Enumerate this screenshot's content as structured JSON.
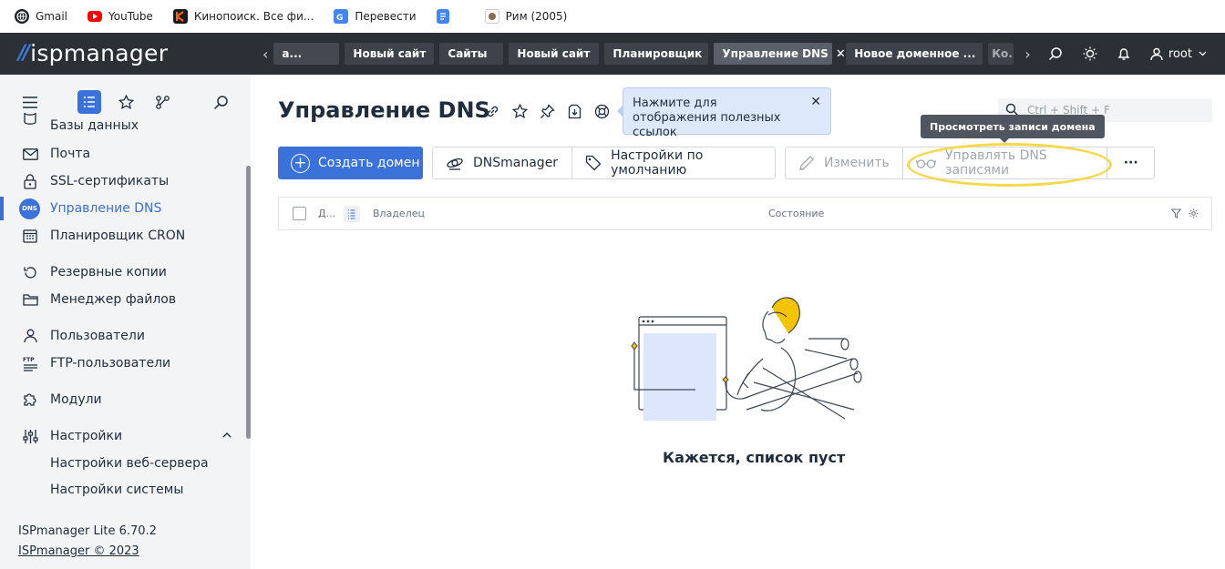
{
  "bookmarks": [
    {
      "label": "Gmail",
      "icon": "globe-icon"
    },
    {
      "label": "YouTube",
      "icon": "youtube-icon"
    },
    {
      "label": "Кинопоиск. Все фи...",
      "icon": "kinopoisk-icon"
    },
    {
      "label": "Перевести",
      "icon": "translate-icon"
    },
    {
      "label": "",
      "icon": "docs-icon"
    },
    {
      "label": "Рим (2005)",
      "icon": "film-icon"
    }
  ],
  "topbar": {
    "logo": "ispmanager",
    "tabs": [
      "а...",
      "Новый сайт",
      "Сайты",
      "Новый сайт",
      "Планировщик",
      "Управление DNS",
      "Новое доменное ...",
      "Ко..."
    ],
    "active_tab": 5,
    "user": "root"
  },
  "sidebar": {
    "items": [
      {
        "label": "Базы данных",
        "icon": "database-icon"
      },
      {
        "label": "Почта",
        "icon": "mail-icon"
      },
      {
        "label": "SSL-сертификаты",
        "icon": "lock-icon"
      },
      {
        "label": "Управление DNS",
        "icon": "dns-icon",
        "active": true
      },
      {
        "label": "Планировщик CRON",
        "icon": "calendar-icon"
      },
      {
        "label": "Резервные копии",
        "icon": "backup-icon"
      },
      {
        "label": "Менеджер файлов",
        "icon": "folder-icon"
      },
      {
        "label": "Пользователи",
        "icon": "user-icon"
      },
      {
        "label": "FTP-пользователи",
        "icon": "ftp-icon"
      },
      {
        "label": "Модули",
        "icon": "puzzle-icon"
      },
      {
        "label": "Настройки",
        "icon": "settings-sliders-icon"
      },
      {
        "label": "Настройки веб-сервера",
        "icon": ""
      },
      {
        "label": "Настройки системы",
        "icon": ""
      }
    ],
    "dns_badge": "DNS",
    "version": "ISPmanager Lite 6.70.2",
    "copyright": "ISPmanager © 2023"
  },
  "main": {
    "title": "Управление DNS",
    "hint": "Нажмите для отображения полезных ссылок",
    "search_placeholder": "Ctrl + Shift + F",
    "tooltip": "Просмотреть записи домена",
    "toolbar": {
      "create": "Создать домен",
      "dnsmanager": "DNSmanager",
      "defaults": "Настройки по умолчанию",
      "edit": "Изменить",
      "manage_records": "Управлять DNS записями",
      "more": "···"
    },
    "table": {
      "columns": [
        "Д...",
        "Владелец",
        "Состояние"
      ]
    },
    "empty_text": "Кажется, список пуст"
  },
  "colors": {
    "topbar": "#2b2f36",
    "accent": "#3b72d9",
    "highlight": "#f5d94a",
    "sidebar": "#f3f4f6"
  }
}
